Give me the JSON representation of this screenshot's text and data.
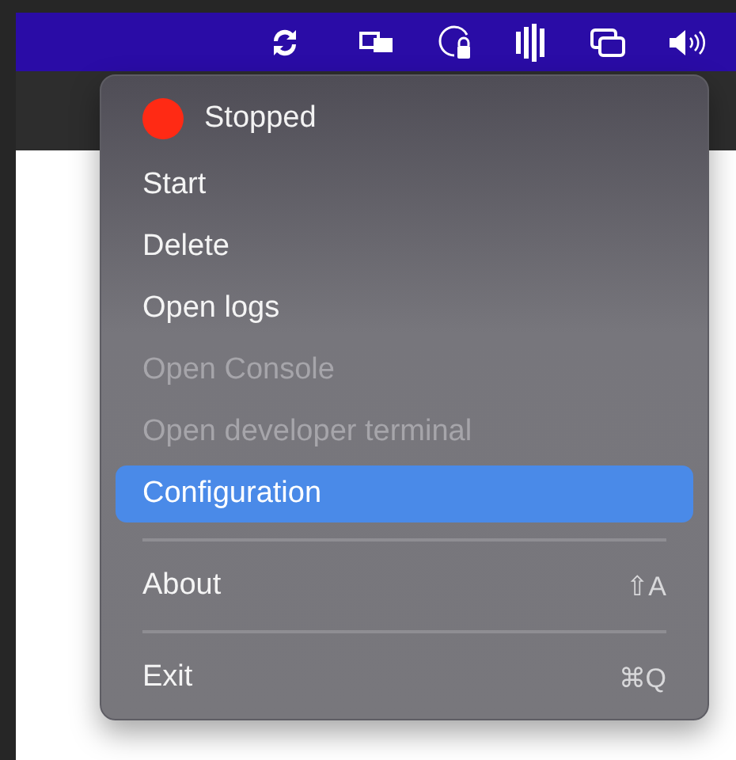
{
  "menu": {
    "items": [
      {
        "kind": "status",
        "label": "Stopped",
        "color": "#ff2a14"
      },
      {
        "kind": "item",
        "label": "Start",
        "disabled": false,
        "selected": false
      },
      {
        "kind": "item",
        "label": "Delete",
        "disabled": false,
        "selected": false
      },
      {
        "kind": "item",
        "label": "Open logs",
        "disabled": false,
        "selected": false
      },
      {
        "kind": "item",
        "label": "Open Console",
        "disabled": true,
        "selected": false
      },
      {
        "kind": "item",
        "label": "Open developer terminal",
        "disabled": true,
        "selected": false
      },
      {
        "kind": "item",
        "label": "Configuration",
        "disabled": false,
        "selected": true
      },
      {
        "kind": "separator"
      },
      {
        "kind": "item",
        "label": "About",
        "shortcut": "⇧A",
        "disabled": false,
        "selected": false
      },
      {
        "kind": "separator"
      },
      {
        "kind": "item",
        "label": "Exit",
        "shortcut": "⌘Q",
        "disabled": false,
        "selected": false
      }
    ]
  }
}
